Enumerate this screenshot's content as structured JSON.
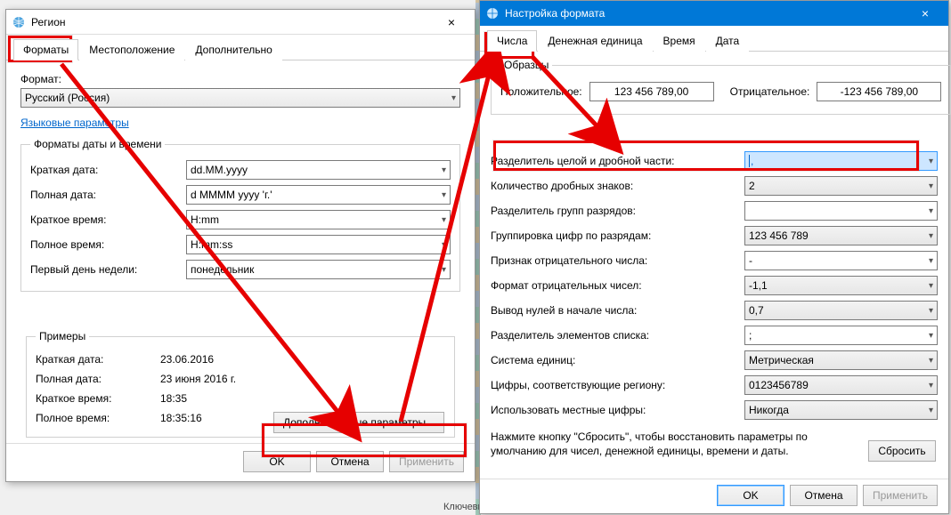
{
  "region": {
    "title": "Регион",
    "tabs": {
      "formats": "Форматы",
      "location": "Местоположение",
      "advanced": "Дополнительно"
    },
    "format_label": "Формат:",
    "format_value": "Русский (Россия)",
    "lang_params_link": "Языковые параметры",
    "dt_legend": "Форматы даты и времени",
    "fields": {
      "short_date_k": "Краткая дата:",
      "short_date_v": "dd.MM.yyyy",
      "long_date_k": "Полная дата:",
      "long_date_v": "d MMMM yyyy 'г.'",
      "short_time_k": "Краткое время:",
      "short_time_v": "H:mm",
      "long_time_k": "Полное время:",
      "long_time_v": "H:mm:ss",
      "first_day_k": "Первый день недели:",
      "first_day_v": "понедельник"
    },
    "examples_legend": "Примеры",
    "examples": {
      "short_date_k": "Краткая дата:",
      "short_date_v": "23.06.2016",
      "long_date_k": "Полная дата:",
      "long_date_v": "23 июня 2016 г.",
      "short_time_k": "Краткое время:",
      "short_time_v": "18:35",
      "long_time_k": "Полное время:",
      "long_time_v": "18:35:16"
    },
    "additional_btn": "Дополнительные параметры...",
    "ok": "OK",
    "cancel": "Отмена",
    "apply": "Применить"
  },
  "format": {
    "title": "Настройка формата",
    "close": "×",
    "tabs": {
      "numbers": "Числа",
      "currency": "Денежная единица",
      "time": "Время",
      "date": "Дата"
    },
    "samples_legend": "Образцы",
    "positive_k": "Положительное:",
    "positive_v": "123 456 789,00",
    "negative_k": "Отрицательное:",
    "negative_v": "-123 456 789,00",
    "rows": {
      "decimal_k": "Разделитель целой и дробной части:",
      "decimal_v": ",",
      "digits_k": "Количество дробных знаков:",
      "digits_v": "2",
      "group_sep_k": "Разделитель групп разрядов:",
      "group_sep_v": " ",
      "grouping_k": "Группировка цифр по разрядам:",
      "grouping_v": "123 456 789",
      "neg_sign_k": "Признак отрицательного числа:",
      "neg_sign_v": "-",
      "neg_fmt_k": "Формат отрицательных чисел:",
      "neg_fmt_v": "-1,1",
      "lead_zero_k": "Вывод нулей в начале числа:",
      "lead_zero_v": "0,7",
      "list_sep_k": "Разделитель элементов списка:",
      "list_sep_v": ";",
      "measure_k": "Система единиц:",
      "measure_v": "Метрическая",
      "region_digits_k": "Цифры, соответствующие региону:",
      "region_digits_v": "0123456789",
      "native_digits_k": "Использовать местные цифры:",
      "native_digits_v": "Никогда"
    },
    "reset_note": "Нажмите кнопку \"Сбросить\", чтобы восстановить параметры по умолчанию для чисел, денежной единицы, времени и даты.",
    "reset": "Сбросить",
    "ok": "OK",
    "cancel": "Отмена",
    "apply": "Применить"
  },
  "misc": {
    "keywords": "Ключевы"
  }
}
